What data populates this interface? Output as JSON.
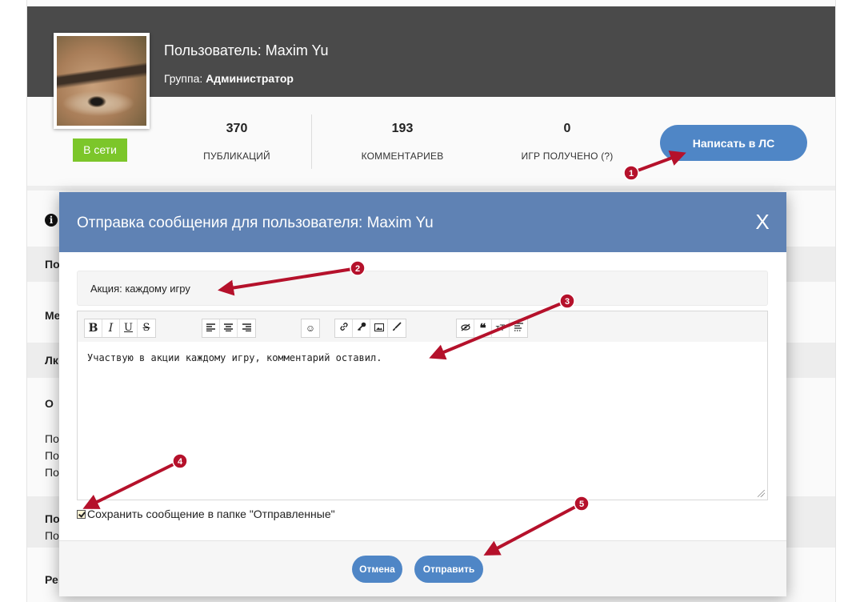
{
  "profile": {
    "name_line": "Пользователь: Maxim Yu",
    "group_prefix": "Группа:",
    "group_value": "Администратор",
    "status_badge": "В сети",
    "stats": [
      {
        "value": "370",
        "label": "ПУБЛИКАЦИЙ"
      },
      {
        "value": "193",
        "label": "КОММЕНТАРИЕВ"
      },
      {
        "value": "0",
        "label": "ИГР ПОЛУЧЕНО (?)"
      }
    ],
    "write_pm_button": "Написать в ЛС",
    "background_rows": [
      "По",
      "Ме",
      "Лк",
      "О",
      "По",
      "По",
      "По",
      "По",
      "По",
      "Ре"
    ]
  },
  "modal": {
    "title": "Отправка сообщения для пользователя: Maxim Yu",
    "close_glyph": "X",
    "subject_value": "Акция: каждому игру",
    "message_text": "Участвую в акции каждому игру, комментарий оставил.",
    "toolbar": [
      [
        "B",
        "I",
        "U",
        "S"
      ],
      [
        "align-left",
        "align-center",
        "align-right"
      ],
      [
        "smile"
      ],
      [
        "link",
        "key",
        "image",
        "brush"
      ],
      [
        "hide",
        "quote",
        "text-size",
        "spoiler"
      ]
    ],
    "save_checkbox_label": "Сохранить сообщение в папке \"Отправленные\"",
    "save_checked": true,
    "cancel_button": "Отмена",
    "send_button": "Отправить"
  },
  "annotations": {
    "color": "#b5112b",
    "markers": [
      "1",
      "2",
      "3",
      "4",
      "5"
    ]
  }
}
